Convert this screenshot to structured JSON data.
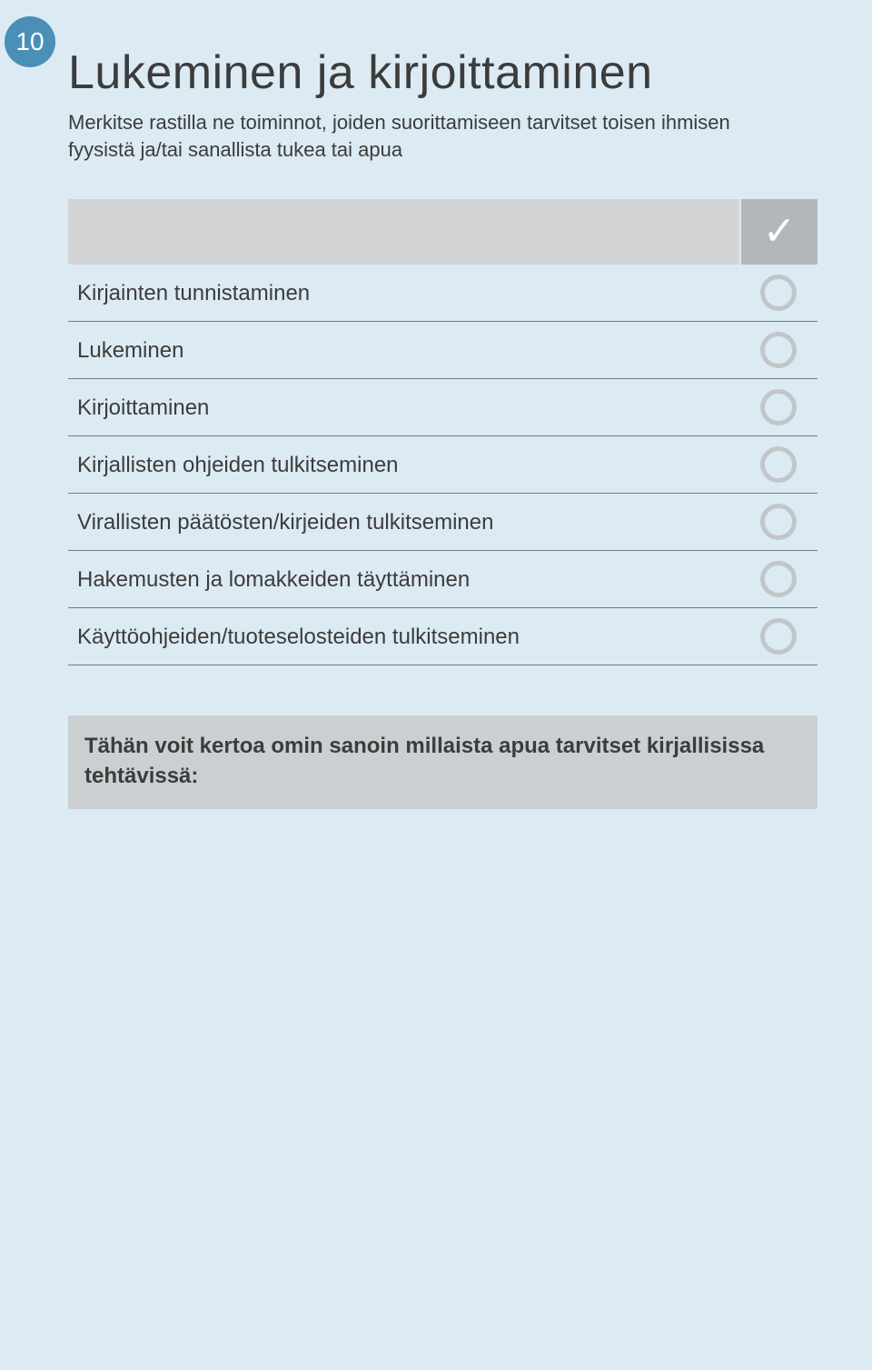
{
  "page_number": "10",
  "heading": "Lukeminen ja kirjoittaminen",
  "subheading": "Merkitse rastilla ne toiminnot, joiden suorittamiseen tarvitset toisen ihmisen fyysistä ja/tai sanallista tukea tai apua",
  "check_symbol": "✓",
  "rows": [
    {
      "label": "Kirjainten tunnistaminen"
    },
    {
      "label": "Lukeminen"
    },
    {
      "label": "Kirjoittaminen"
    },
    {
      "label": "Kirjallisten ohjeiden tulkitseminen"
    },
    {
      "label": "Virallisten päätösten/kirjeiden tulkitseminen"
    },
    {
      "label": "Hakemusten ja lomakkeiden täyttäminen"
    },
    {
      "label": "Käyttöohjeiden/tuoteselosteiden tulkitseminen"
    }
  ],
  "notes_prompt": "Tähän voit kertoa omin sanoin millaista apua tarvitset kirjallisissa tehtävissä:"
}
